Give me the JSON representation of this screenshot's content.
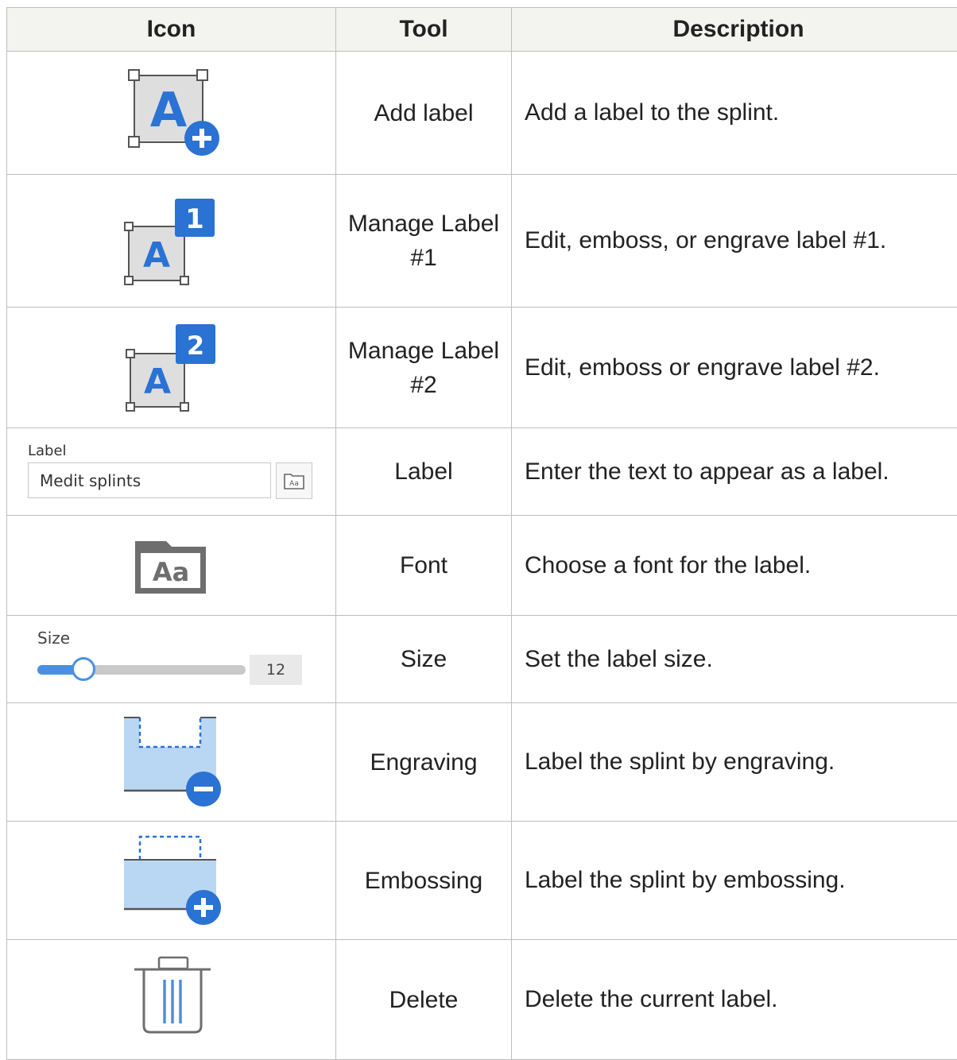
{
  "header": {
    "icon": "Icon",
    "tool": "Tool",
    "description": "Description"
  },
  "colors": {
    "accent": "#2a72d4",
    "panel": "#b9d7f3",
    "icon_gray": "#6e6e6e"
  },
  "rows": [
    {
      "icon": "add-label-icon",
      "tool": "Add label",
      "description": "Add a label to the splint."
    },
    {
      "icon": "manage-label-1-icon",
      "badge": "1",
      "letter": "A",
      "tool": "Manage Label #1",
      "description": "Edit, emboss, or engrave label #1."
    },
    {
      "icon": "manage-label-2-icon",
      "badge": "2",
      "letter": "A",
      "tool": "Manage Label #2",
      "description": "Edit, emboss or engrave label #2."
    },
    {
      "icon": "label-field",
      "field_label": "Label",
      "field_value": "Medit splints",
      "tool": "Label",
      "description": "Enter the text to appear as a label."
    },
    {
      "icon": "font-icon",
      "glyph": "Aa",
      "tool": "Font",
      "description": "Choose a font for the label."
    },
    {
      "icon": "size-slider",
      "slider_label": "Size",
      "slider_value": "12",
      "slider_fraction": 0.22,
      "tool": "Size",
      "description": "Set the label size."
    },
    {
      "icon": "engraving-icon",
      "tool": "Engraving",
      "description": "Label the splint by engraving."
    },
    {
      "icon": "embossing-icon",
      "tool": "Embossing",
      "description": "Label the splint by embossing."
    },
    {
      "icon": "trash-icon",
      "tool": "Delete",
      "description": "Delete the current label."
    }
  ]
}
